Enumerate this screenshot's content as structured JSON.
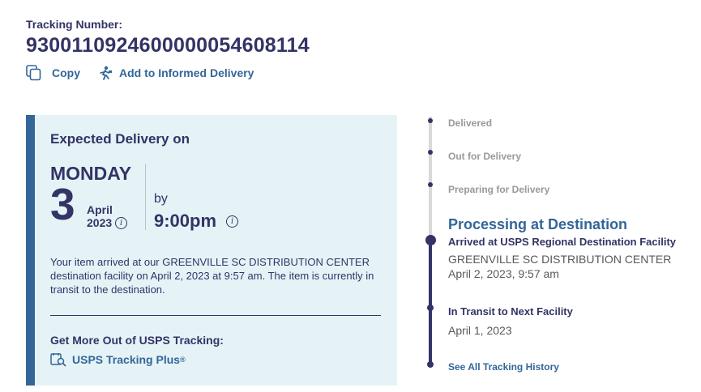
{
  "tracking": {
    "label": "Tracking Number:",
    "number": "9300110924600000054608114",
    "actions": {
      "copy_label": "Copy",
      "informed_label": "Add to Informed Delivery"
    }
  },
  "expected": {
    "title": "Expected Delivery on",
    "weekday": "MONDAY",
    "day": "3",
    "month": "April",
    "year": "2023",
    "by_label": "by",
    "time": "9:00pm",
    "description": "Your item arrived at our GREENVILLE SC DISTRIBUTION CENTER destination facility on April 2, 2023 at 9:57 am. The item is currently in transit to the destination.",
    "more_title": "Get More Out of USPS Tracking:",
    "plus_label": "USPS Tracking Plus",
    "plus_mark": "®"
  },
  "timeline": {
    "steps": [
      "Delivered",
      "Out for Delivery",
      "Preparing for Delivery"
    ],
    "current_status": "Processing at Destination",
    "events": [
      {
        "title": "Arrived at USPS Regional Destination Facility",
        "location": "GREENVILLE SC DISTRIBUTION CENTER",
        "datetime": "April 2, 2023, 9:57 am"
      },
      {
        "title": "In Transit to Next Facility",
        "datetime": "April 1, 2023"
      }
    ],
    "see_all": "See All Tracking History"
  },
  "colors": {
    "navy": "#333366",
    "link_blue": "#336699",
    "card_bg": "#e5f3f7",
    "muted_gray": "#999999"
  }
}
